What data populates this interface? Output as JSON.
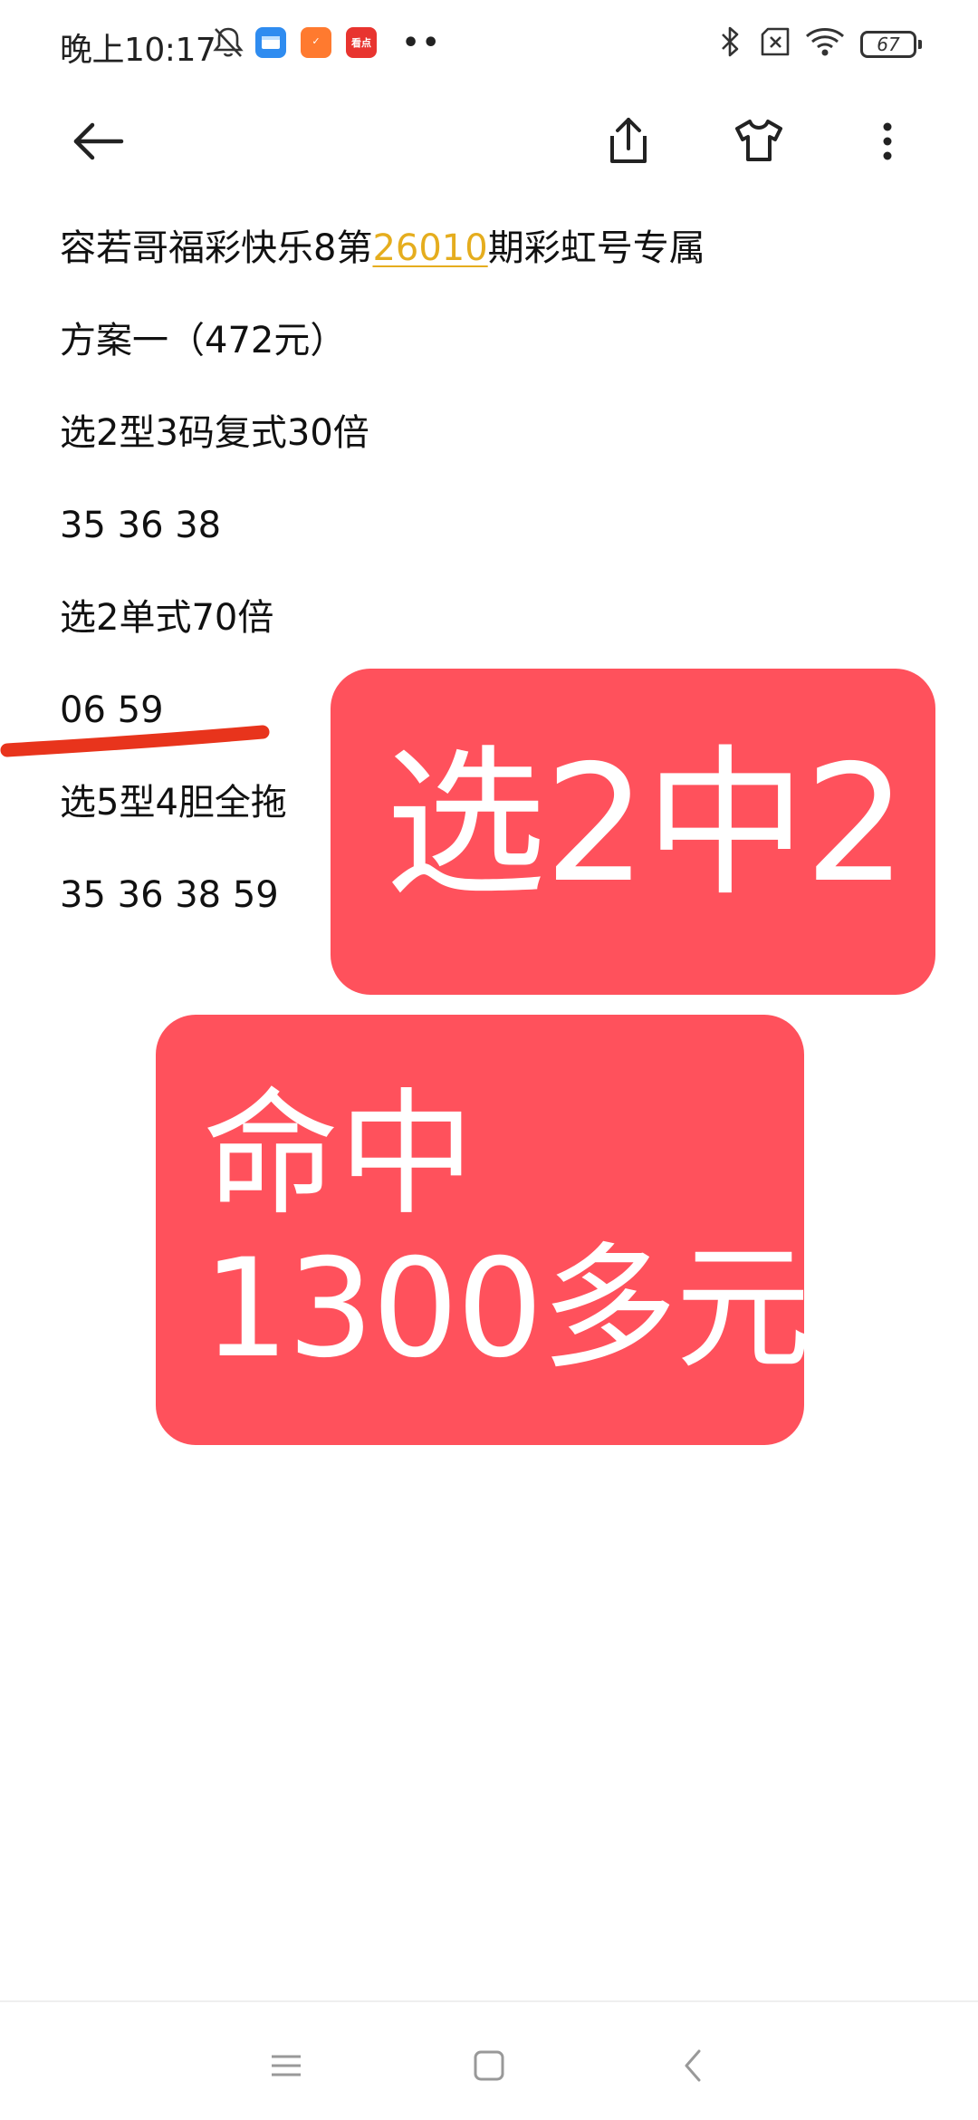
{
  "status_bar": {
    "time": "晚上10:17",
    "battery_level": "67",
    "app_badges": [
      {
        "name": "mail-app",
        "label": ""
      },
      {
        "name": "shop-app",
        "label": "✓"
      },
      {
        "name": "news-app",
        "label": "看点"
      }
    ],
    "more_indicator": "••"
  },
  "toolbar": {
    "icons": [
      "back-arrow-icon",
      "share-icon",
      "tshirt-icon",
      "more-vert-icon"
    ]
  },
  "note": {
    "title_prefix": "容若哥福彩快乐8第",
    "issue_number": "26010",
    "title_suffix": "期彩虹号专属",
    "plan": "方案一（472元）",
    "bet1_type": "选2型3码复式30倍",
    "bet1_numbers": "35 36 38",
    "bet2_type": "选2单式70倍",
    "bet2_numbers": "06 59",
    "bet3_type": "选5型4胆全拖",
    "bet3_numbers": "35 36 38 59"
  },
  "overlays": {
    "result": "选2中2",
    "hit_line1": "命中",
    "hit_line2": "1300多元"
  },
  "colors": {
    "accent_link": "#e5ad1e",
    "sticker_red": "#ff515c",
    "marker_red": "#e8341c"
  },
  "nav_bar": {
    "icons": [
      "menu-icon",
      "home-square-icon",
      "back-chevron-icon"
    ]
  }
}
